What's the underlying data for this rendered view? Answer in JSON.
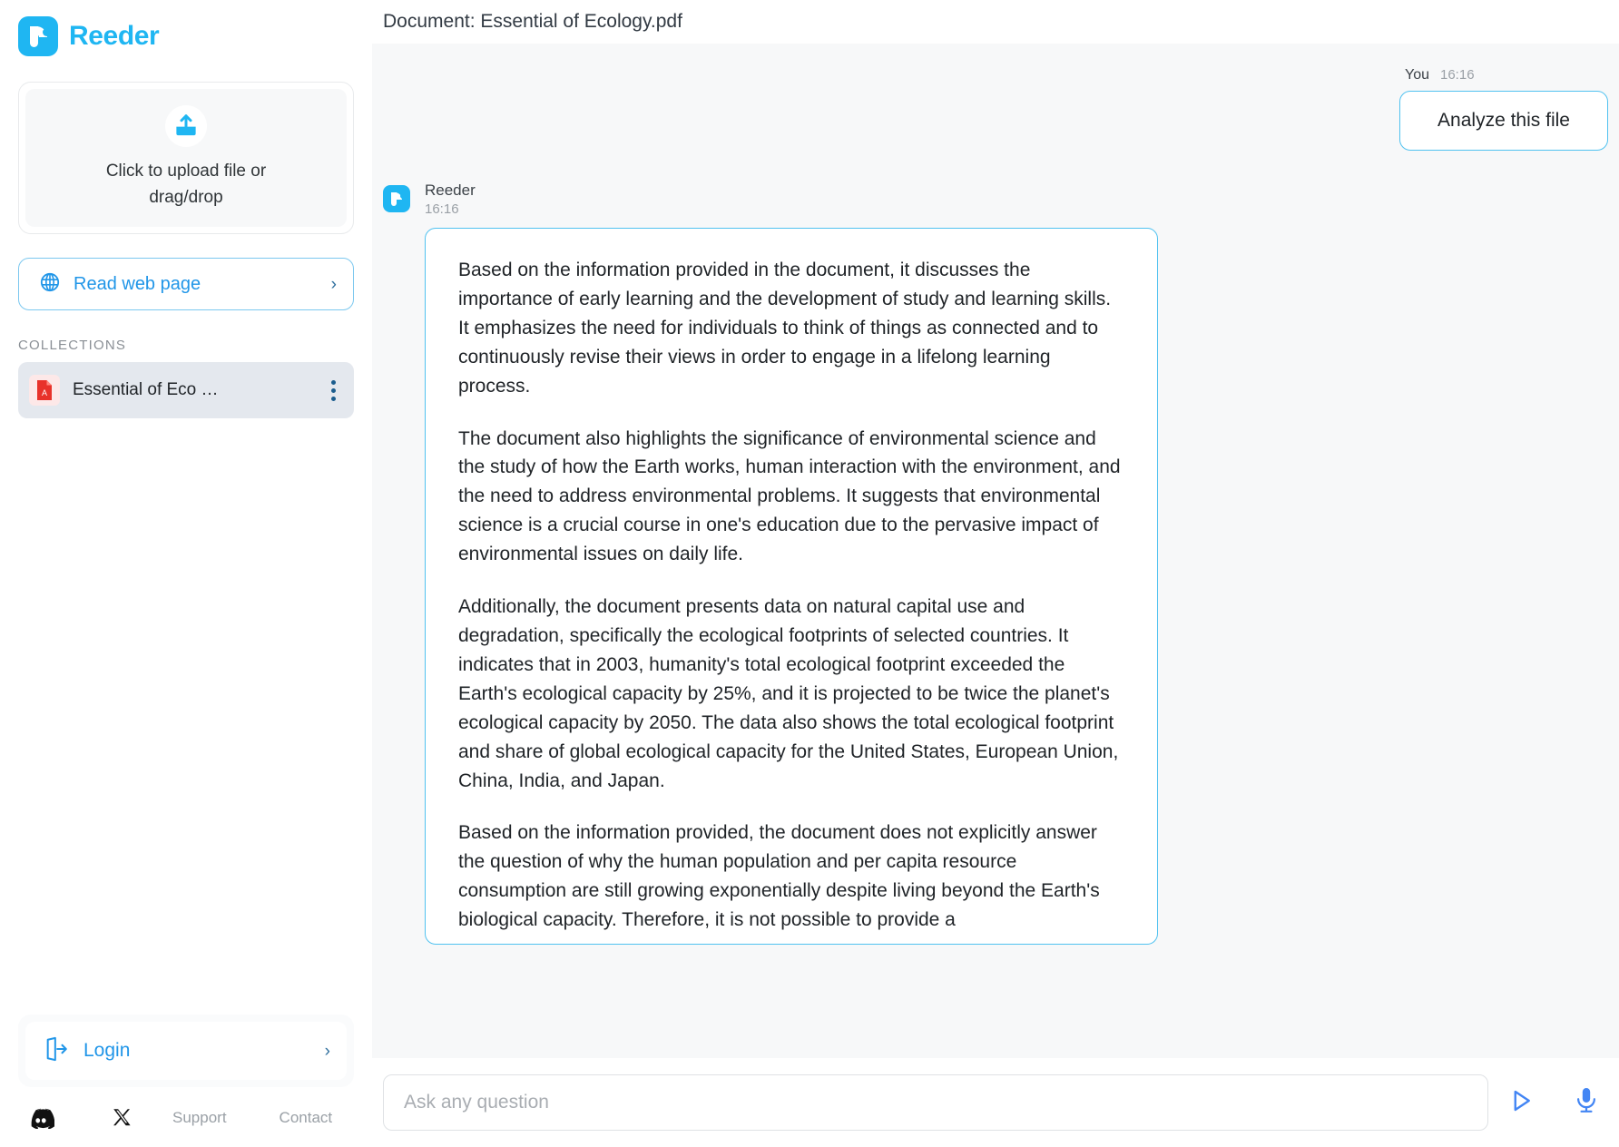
{
  "brand": {
    "name": "Reeder"
  },
  "sidebar": {
    "upload": {
      "icon": "upload-icon",
      "label": "Click to upload file or drag/drop"
    },
    "read_web_page": {
      "icon": "globe-icon",
      "label": "Read web page",
      "chevron": "›"
    },
    "collections": {
      "title": "COLLECTIONS",
      "items": [
        {
          "name": "Essential of Eco …",
          "icon": "pdf-file-icon",
          "menu_icon": "kebab-menu-icon"
        }
      ]
    },
    "login": {
      "icon": "login-door-icon",
      "label": "Login",
      "chevron": "›"
    },
    "footer": {
      "discord_icon": "discord-icon",
      "x_icon": "x-twitter-icon",
      "support": "Support",
      "contact": "Contact"
    }
  },
  "header": {
    "title": "Document: Essential of Ecology.pdf"
  },
  "chat": {
    "user_message": {
      "author": "You",
      "time": "16:16",
      "text": "Analyze this file"
    },
    "bot_message": {
      "author": "Reeder",
      "time": "16:16",
      "paragraphs": [
        "Based on the information provided in the document, it discusses the importance of early learning and the development of study and learning skills. It emphasizes the need for individuals to think of things as connected and to continuously revise their views in order to engage in a lifelong learning process.",
        "The document also highlights the significance of environmental science and the study of how the Earth works, human interaction with the environment, and the need to address environmental problems. It suggests that environmental science is a crucial course in one's education due to the pervasive impact of environmental issues on daily life.",
        "Additionally, the document presents data on natural capital use and degradation, specifically the ecological footprints of selected countries. It indicates that in 2003, humanity's total ecological footprint exceeded the Earth's ecological capacity by 25%, and it is projected to be twice the planet's ecological capacity by 2050. The data also shows the total ecological footprint and share of global ecological capacity for the United States, European Union, China, India, and Japan.",
        "Based on the information provided, the document does not explicitly answer the question of why the human population and per capita resource consumption are still growing exponentially despite living beyond the Earth's biological capacity. Therefore, it is not possible to provide a"
      ]
    }
  },
  "composer": {
    "placeholder": "Ask any question",
    "value": "",
    "send_icon": "send-triangle-icon",
    "mic_icon": "microphone-icon"
  },
  "colors": {
    "brand_blue": "#1fb6f2",
    "accent_blue": "#2196e8",
    "bubble_border": "#51c2f0",
    "chat_bg": "#f7f8f9",
    "action_blue": "#4285f4",
    "pdf_red": "#e8322a"
  }
}
